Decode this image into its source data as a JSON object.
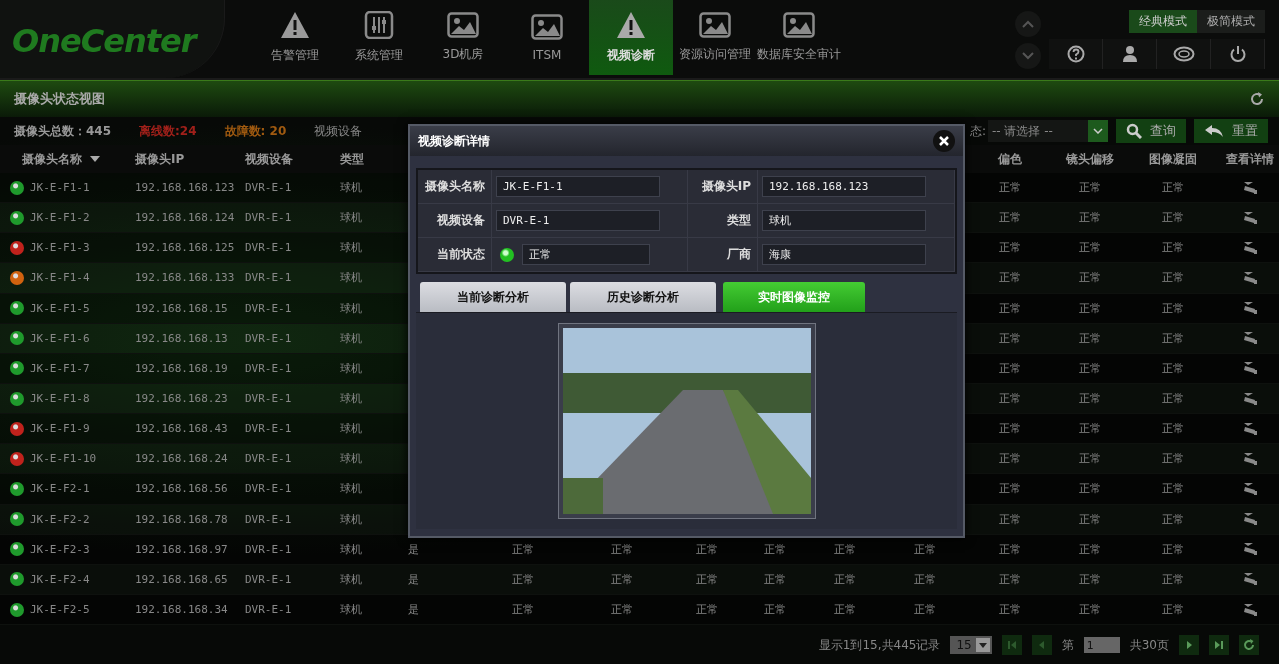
{
  "logo": "OneCenter",
  "nav": [
    {
      "label": "告警管理",
      "kind": "warning",
      "selected": false
    },
    {
      "label": "系统管理",
      "kind": "sliders",
      "selected": false
    },
    {
      "label": "3D机房",
      "kind": "image",
      "selected": false
    },
    {
      "label": "ITSM",
      "kind": "image",
      "selected": false
    },
    {
      "label": "视频诊断",
      "kind": "warning",
      "selected": true
    },
    {
      "label": "资源访问管理",
      "kind": "image",
      "selected": false
    },
    {
      "label": "数据库安全审计",
      "kind": "image",
      "selected": false
    }
  ],
  "modes": [
    {
      "label": "经典模式",
      "selected": true
    },
    {
      "label": "极简模式",
      "selected": false
    }
  ],
  "panel": {
    "title": "摄像头状态视图"
  },
  "summary": {
    "total": "摄像头总数：445",
    "offline": "离线数:24",
    "fault": "故障数: 20",
    "device_label": "视频设备",
    "status_label": "态:",
    "status_select": "-- 请选择 --",
    "query": "查询",
    "reset": "重置"
  },
  "table": {
    "left_columns": [
      "摄像头名称",
      "摄像头IP",
      "视频设备",
      "类型"
    ],
    "right_columns": [
      "偏色",
      "镜头偏移",
      "图像凝固",
      "查看详情"
    ],
    "rows": [
      {
        "color": "#1f9a2c",
        "name": "JK-E-F1-1",
        "ip": "192.168.168.123",
        "device": "DVR-E-1",
        "type": "球机",
        "right": [
          "正常",
          "正常",
          "正常"
        ]
      },
      {
        "color": "#1f9a2c",
        "name": "JK-E-F1-2",
        "ip": "192.168.168.124",
        "device": "DVR-E-1",
        "type": "球机",
        "right": [
          "正常",
          "正常",
          "正常"
        ]
      },
      {
        "color": "#c0221c",
        "name": "JK-E-F1-3",
        "ip": "192.168.168.125",
        "device": "DVR-E-1",
        "type": "球机",
        "right": [
          "正常",
          "正常",
          "正常"
        ]
      },
      {
        "color": "#d0620f",
        "name": "JK-E-F1-4",
        "ip": "192.168.168.133",
        "device": "DVR-E-1",
        "type": "球机",
        "right": [
          "正常",
          "正常",
          "正常"
        ]
      },
      {
        "color": "#1f9a2c",
        "name": "JK-E-F1-5",
        "ip": "192.168.168.15",
        "device": "DVR-E-1",
        "type": "球机",
        "right": [
          "正常",
          "正常",
          "正常"
        ]
      },
      {
        "color": "#1f9a2c",
        "name": "JK-E-F1-6",
        "ip": "192.168.168.13",
        "device": "DVR-E-1",
        "type": "球机",
        "right": [
          "正常",
          "正常",
          "正常"
        ]
      },
      {
        "color": "#1f9a2c",
        "name": "JK-E-F1-7",
        "ip": "192.168.168.19",
        "device": "DVR-E-1",
        "type": "球机",
        "right": [
          "正常",
          "正常",
          "正常"
        ]
      },
      {
        "color": "#1f9a2c",
        "name": "JK-E-F1-8",
        "ip": "192.168.168.23",
        "device": "DVR-E-1",
        "type": "球机",
        "right": [
          "正常",
          "正常",
          "正常"
        ]
      },
      {
        "color": "#c0221c",
        "name": "JK-E-F1-9",
        "ip": "192.168.168.43",
        "device": "DVR-E-1",
        "type": "球机",
        "right": [
          "正常",
          "正常",
          "正常"
        ]
      },
      {
        "color": "#c0221c",
        "name": "JK-E-F1-10",
        "ip": "192.168.168.24",
        "device": "DVR-E-1",
        "type": "球机",
        "right": [
          "正常",
          "正常",
          "正常"
        ]
      },
      {
        "color": "#1f9a2c",
        "name": "JK-E-F2-1",
        "ip": "192.168.168.56",
        "device": "DVR-E-1",
        "type": "球机",
        "right": [
          "正常",
          "正常",
          "正常"
        ]
      },
      {
        "color": "#1f9a2c",
        "name": "JK-E-F2-2",
        "ip": "192.168.168.78",
        "device": "DVR-E-1",
        "type": "球机",
        "right": [
          "正常",
          "正常",
          "正常"
        ]
      },
      {
        "color": "#1f9a2c",
        "name": "JK-E-F2-3",
        "ip": "192.168.168.97",
        "device": "DVR-E-1",
        "type": "球机",
        "middle": [
          "是",
          "正常",
          "正常",
          "正常",
          "正常",
          "正常",
          "正常"
        ],
        "right": [
          "正常",
          "正常",
          "正常"
        ]
      },
      {
        "color": "#1f9a2c",
        "name": "JK-E-F2-4",
        "ip": "192.168.168.65",
        "device": "DVR-E-1",
        "type": "球机",
        "middle": [
          "是",
          "正常",
          "正常",
          "正常",
          "正常",
          "正常",
          "正常"
        ],
        "right": [
          "正常",
          "正常",
          "正常"
        ]
      },
      {
        "color": "#1f9a2c",
        "name": "JK-E-F2-5",
        "ip": "192.168.168.34",
        "device": "DVR-E-1",
        "type": "球机",
        "middle": [
          "是",
          "正常",
          "正常",
          "正常",
          "正常",
          "正常",
          "正常"
        ],
        "right": [
          "正常",
          "正常",
          "正常"
        ]
      }
    ]
  },
  "pager": {
    "info": "显示1到15,共445记录",
    "page_size": "15",
    "page_prefix": "第",
    "page": "1",
    "page_total": "共30页"
  },
  "dialog": {
    "title": "视频诊断详情",
    "fields": [
      {
        "label": "摄像头名称",
        "value": "JK-E-F1-1"
      },
      {
        "label": "摄像头IP",
        "value": "192.168.168.123"
      },
      {
        "label": "视频设备",
        "value": "DVR-E-1"
      },
      {
        "label": "类型",
        "value": "球机"
      },
      {
        "label": "当前状态",
        "value": "正常",
        "color": "#22c022"
      },
      {
        "label": "厂商",
        "value": "海康"
      }
    ],
    "tabs": [
      {
        "label": "当前诊断分析",
        "selected": false
      },
      {
        "label": "历史诊断分析",
        "selected": false
      },
      {
        "label": "实时图像监控",
        "selected": true
      }
    ]
  }
}
